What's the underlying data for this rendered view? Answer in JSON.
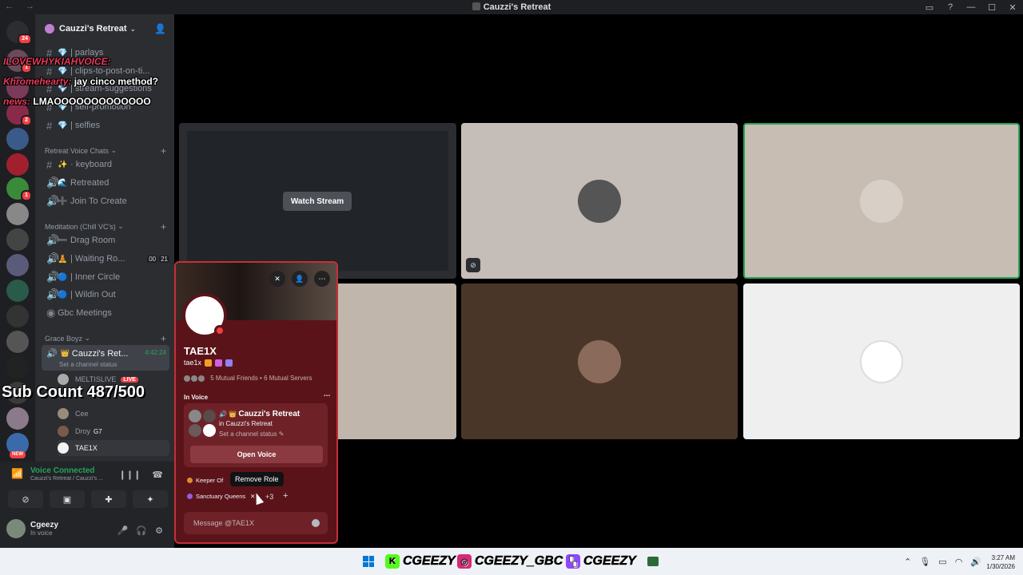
{
  "titlebar": {
    "nav": "← →",
    "title": "Cauzzi's Retreat",
    "controls": [
      "▭",
      "?",
      "—",
      "☐",
      "✕"
    ]
  },
  "rail": {
    "badges": [
      "24",
      "1",
      "2",
      "1"
    ],
    "new_label": "NEW"
  },
  "server": {
    "name": "Cauzzi's Retreat",
    "chevron": "⌄",
    "add_user_icon": "👤"
  },
  "channels": {
    "top": [
      {
        "emoji": "💎",
        "label": "| parlays"
      },
      {
        "emoji": "💎",
        "label": "| clips-to-post-on-ti..."
      },
      {
        "emoji": "💎",
        "label": "| stream-suggestions"
      },
      {
        "emoji": "💎",
        "label": "| self-promotion"
      },
      {
        "emoji": "💎",
        "label": "| selfies"
      }
    ],
    "cat_retreat": "Retreat Voice Chats",
    "retreat": [
      {
        "emoji": "✨",
        "label": "· keyboard"
      },
      {
        "emoji": "🌊",
        "label": "Retreated"
      },
      {
        "emoji": "➕",
        "label": "Join To Create"
      }
    ],
    "cat_meditation": "Meditation (Chill VC's)",
    "meditation": [
      {
        "emoji": "➖",
        "label": "Drag Room"
      },
      {
        "emoji": "🧘",
        "label": "| Waiting Ro..."
      },
      {
        "emoji": "🔵",
        "label": "| Inner Circle"
      },
      {
        "emoji": "🔵",
        "label": "| Wildin Out"
      },
      {
        "emoji": "",
        "label": "Gbc Meetings"
      }
    ],
    "waiting_counts": [
      "00",
      "21"
    ],
    "cat_grace": "Grace Boyz",
    "active": {
      "label": "Cauzzi's Ret...",
      "time": "4:42:24",
      "status": "Set a channel status"
    },
    "users": [
      {
        "name": "MELTISLIVE",
        "live": "LIVE"
      },
      {
        "name": "Cee"
      },
      {
        "name": "Droy",
        "tag": "G7"
      },
      {
        "name": "TAE1X"
      }
    ]
  },
  "voice_panel": {
    "status": "Voice Connected",
    "location": "Cauzzi's Retreat / Cauzzi's ...",
    "user_name": "Cgeezy",
    "user_status": "In voice"
  },
  "chat_overlay": [
    {
      "user": "ILOVEWHYKIAHVOICE:",
      "msg": "",
      "color": "#e83a5c"
    },
    {
      "user": "Khromehearty:",
      "msg": "jay cinco method?",
      "color": "#e83a5c"
    },
    {
      "user": "news:",
      "msg": "LMAOOOOOOOOOOOOO",
      "color": "#e83a5c"
    }
  ],
  "sub_count": "Sub Count 487/500",
  "stream": {
    "watch_label": "Watch Stream"
  },
  "profile": {
    "display_name": "TAE1X",
    "username": "tae1x",
    "mutual": "5 Mutual Friends • 6 Mutual Servers",
    "in_voice_label": "In Voice",
    "channel_name": "Cauzzi's Retreat",
    "channel_in": "in Cauzzi's Retreat",
    "channel_status": "Set a channel status",
    "open_voice": "Open Voice",
    "role1": "Keeper Of",
    "tooltip": "Remove Role",
    "role2": "Sanctuary Queens",
    "role_more": "+3",
    "message_placeholder": "Message @TAE1X"
  },
  "taskbar": {
    "handle1": "CGEEZY",
    "handle2": "CGEEZY_GBC",
    "handle3": "CGEEZY",
    "time": "3:27 AM",
    "date": "1/30/2026"
  }
}
